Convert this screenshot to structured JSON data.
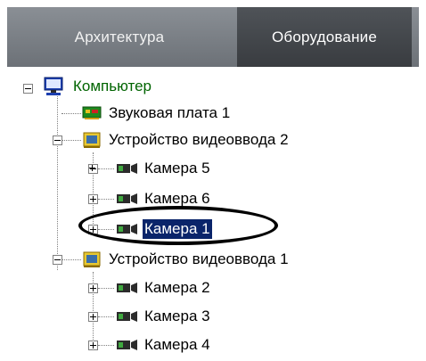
{
  "tabs": [
    {
      "label": "Архитектура",
      "active": false
    },
    {
      "label": "Оборудование",
      "active": true
    }
  ],
  "tree": {
    "root": "Компьютер",
    "items": [
      {
        "label": "Звуковая плата 1",
        "icon": "sound-card-icon"
      },
      {
        "label": "Устройство видеоввода 2",
        "icon": "video-capture-device-icon"
      },
      {
        "label": "Камера 5",
        "icon": "camera-icon"
      },
      {
        "label": "Камера 6",
        "icon": "camera-icon"
      },
      {
        "label": "Камера 1",
        "icon": "camera-icon",
        "selected": true
      },
      {
        "label": "Устройство видеоввода 1",
        "icon": "video-capture-device-icon"
      },
      {
        "label": "Камера 2",
        "icon": "camera-icon"
      },
      {
        "label": "Камера 3",
        "icon": "camera-icon"
      },
      {
        "label": "Камера 4",
        "icon": "camera-icon"
      }
    ]
  },
  "colors": {
    "selection": "#0a246a",
    "root_text": "#006400",
    "tab_active": "#45494e",
    "tab_inactive": "#7b8086"
  }
}
